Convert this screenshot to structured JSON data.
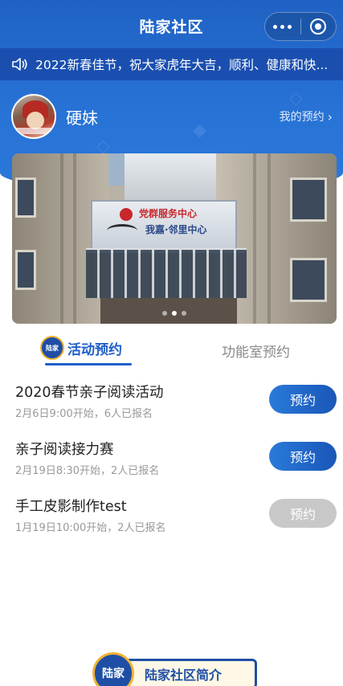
{
  "app": {
    "title": "陆家社区"
  },
  "capsule": {
    "more_icon": "more-dots-icon",
    "close_icon": "target-icon"
  },
  "notice": {
    "icon": "speaker-icon",
    "text": "2022新春佳节，祝大家虎年大吉，顺利、健康和快..."
  },
  "user": {
    "name": "硬妹",
    "my_booking_label": "我的预约",
    "chevron": "›"
  },
  "banner": {
    "sign_line1": "党群服务中心",
    "sign_line2": "我嘉·邻里中心",
    "pager_count": 3,
    "active_index": 1
  },
  "tabs": {
    "badge_text": "陆家",
    "active_label": "活动预约",
    "inactive_label": "功能室预约"
  },
  "activities": [
    {
      "name": "2020春节亲子阅读活动",
      "meta": "2月6日9:00开始，6人已报名",
      "button": "预约",
      "enabled": true
    },
    {
      "name": "亲子阅读接力赛",
      "meta": "2月19日8:30开始，2人已报名",
      "button": "预约",
      "enabled": true
    },
    {
      "name": "手工皮影制作test",
      "meta": "1月19日10:00开始，2人已报名",
      "button": "预约",
      "enabled": false
    }
  ],
  "intro": {
    "badge": "陆家",
    "label": "陆家社区简介"
  },
  "colors": {
    "primary": "#1f5fc8",
    "notice_bg": "#1a4fb0",
    "accent": "#f2b233",
    "disabled": "#c8c8c8"
  }
}
